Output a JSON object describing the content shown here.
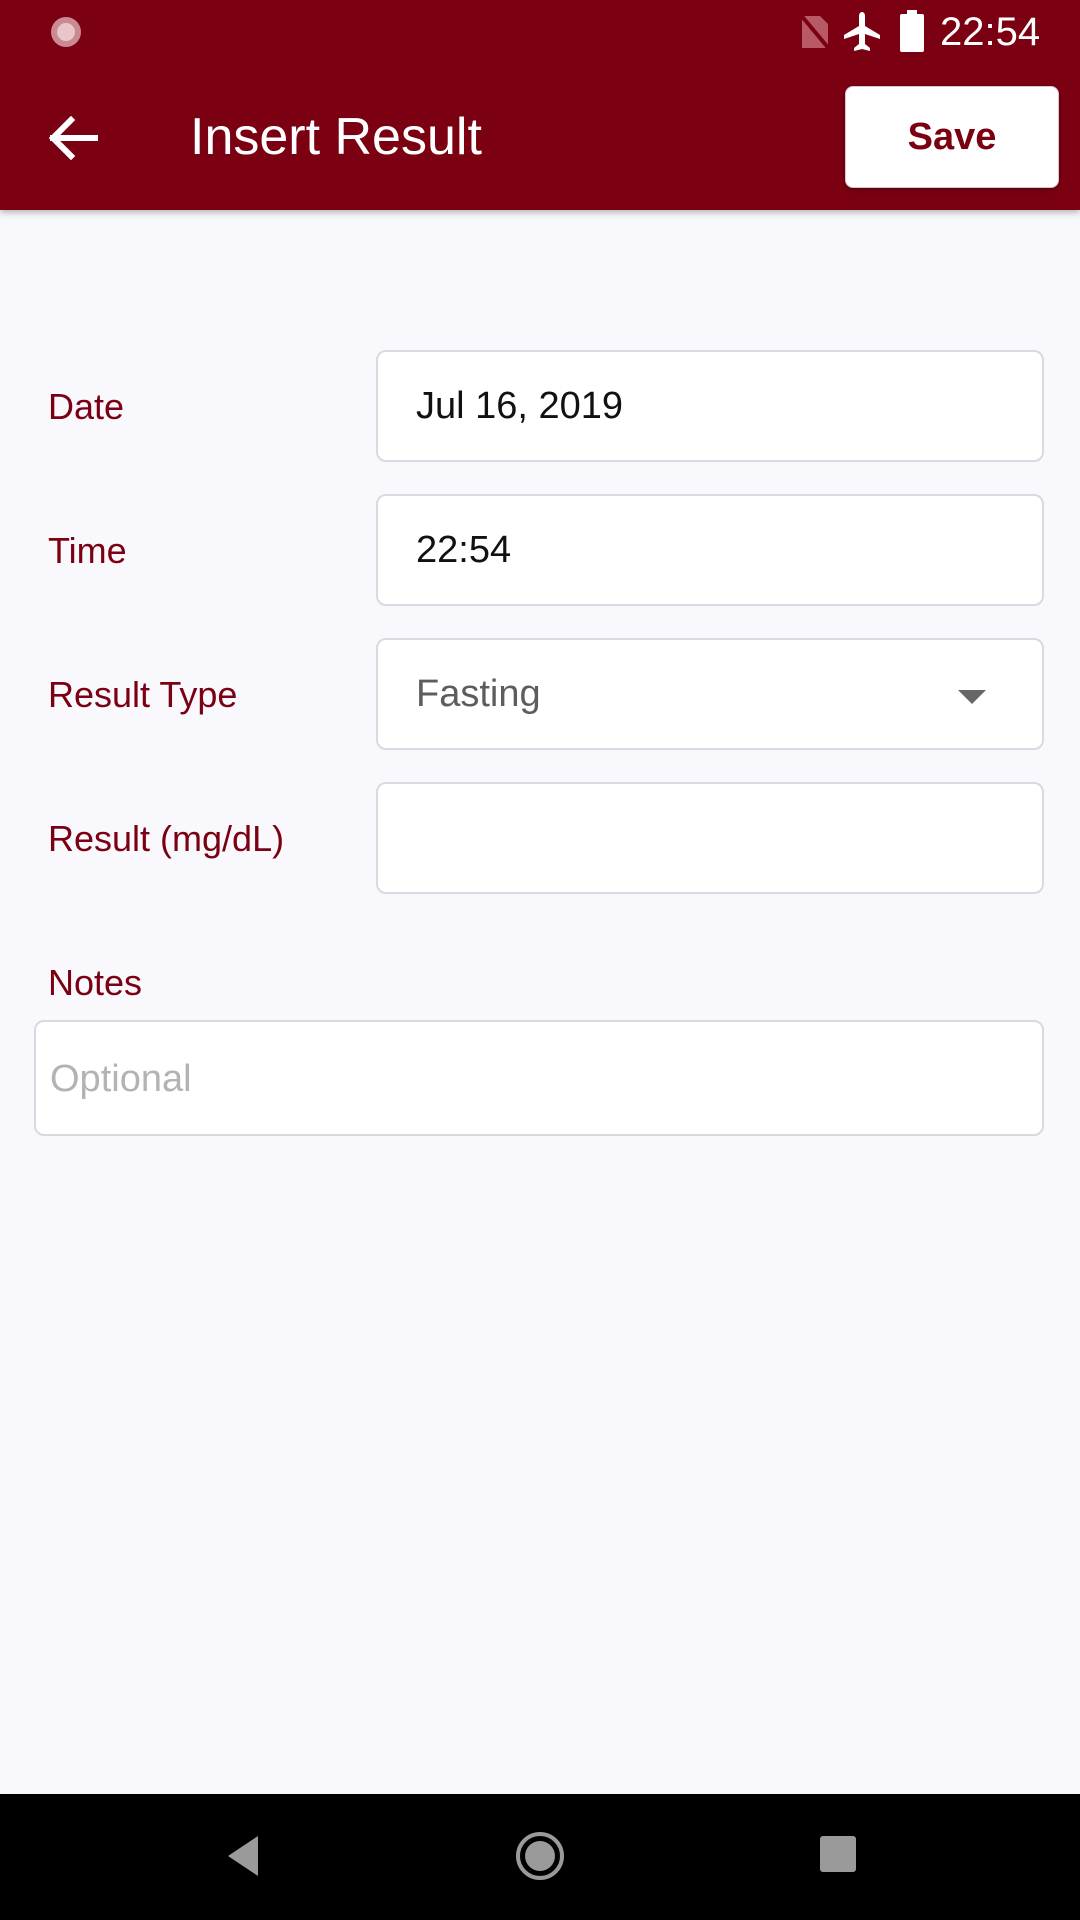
{
  "status_bar": {
    "time": "22:54",
    "icons": [
      "loading-indicator-icon",
      "no-sim-icon",
      "airplane-mode-icon",
      "battery-icon"
    ]
  },
  "toolbar": {
    "back_icon": "arrow-back-icon",
    "title": "Insert Result",
    "save_label": "Save"
  },
  "form": {
    "date": {
      "label": "Date",
      "value": "Jul 16, 2019"
    },
    "time": {
      "label": "Time",
      "value": "22:54"
    },
    "result_type": {
      "label": "Result Type",
      "selected": "Fasting"
    },
    "result": {
      "label": "Result (mg/dL)",
      "value": ""
    },
    "notes": {
      "label": "Notes",
      "placeholder": "Optional",
      "value": ""
    }
  },
  "nav_bar": {
    "icons": [
      "nav-back-icon",
      "nav-home-icon",
      "nav-recents-icon"
    ]
  },
  "colors": {
    "primary": "#7a0012",
    "background": "#f8f8fd",
    "field_border": "#d9d9e0",
    "placeholder": "#b3b3b3"
  }
}
